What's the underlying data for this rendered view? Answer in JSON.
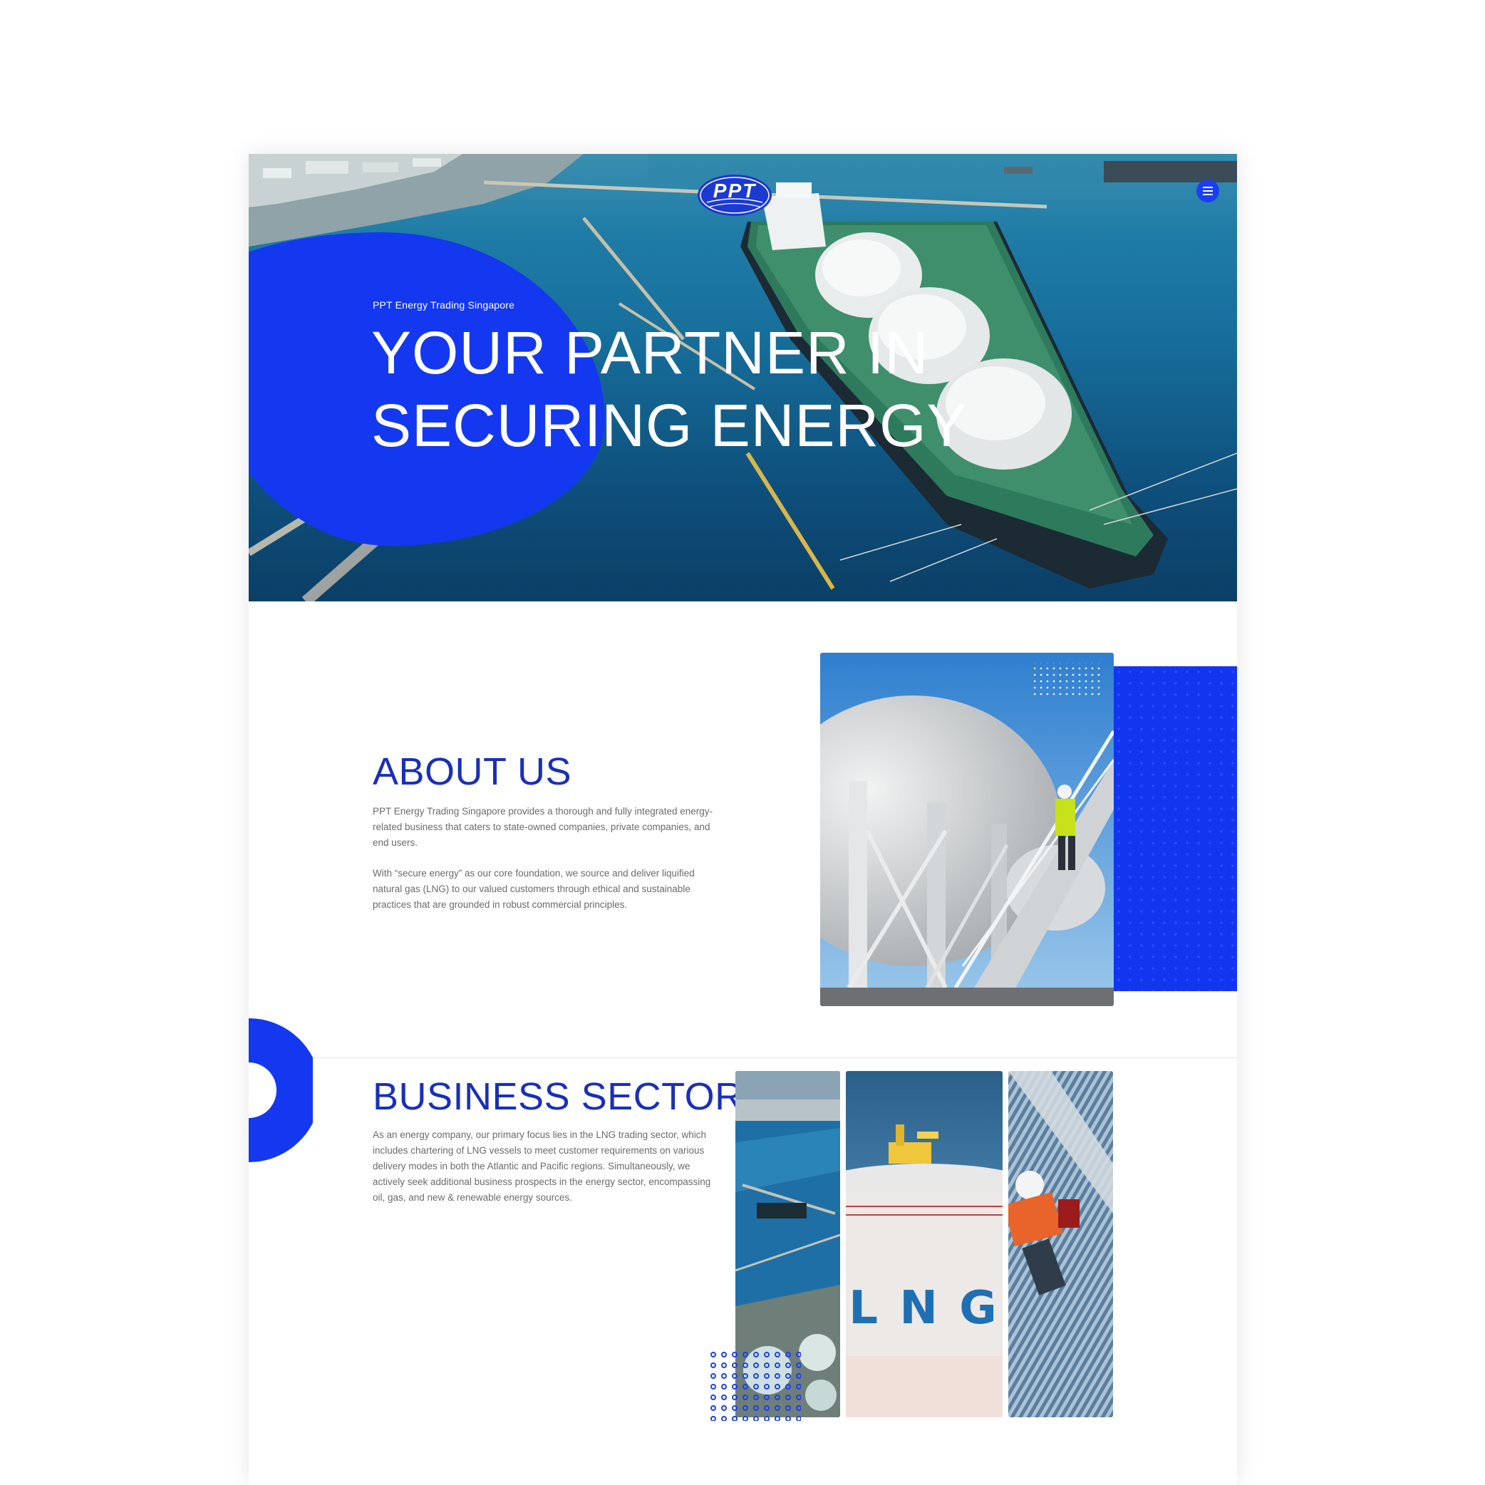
{
  "header": {
    "logo_text": "PPT",
    "menu_icon": "hamburger-menu-icon"
  },
  "hero": {
    "subtitle": "PPT Energy Trading Singapore",
    "title_line1": "YOUR PARTNER IN",
    "title_line2": "SECURING ENERGY"
  },
  "about": {
    "title": "ABOUT US",
    "paragraph1": "PPT Energy Trading Singapore provides a thorough and fully integrated energy-related business that caters to state-owned companies, private companies, and end users.",
    "paragraph2": "With “secure energy” as our core foundation, we source and deliver liquified natural gas (LNG) to our valued customers through ethical and sustainable practices that are grounded in robust commercial principles."
  },
  "business": {
    "title": "BUSINESS SECTOR",
    "paragraph": "As an energy company, our primary focus lies in the LNG trading sector, which includes chartering of LNG vessels to meet customer requirements on various delivery modes in both the Atlantic and Pacific regions. Simultaneously, we actively seek additional business prospects in the energy sector, encompassing oil, gas, and new & renewable energy sources.",
    "tank_lettering": "L N G"
  },
  "colors": {
    "brand_blue": "#1438f0",
    "heading_blue": "#1a2fb8",
    "body_text": "#6b6b6b"
  }
}
